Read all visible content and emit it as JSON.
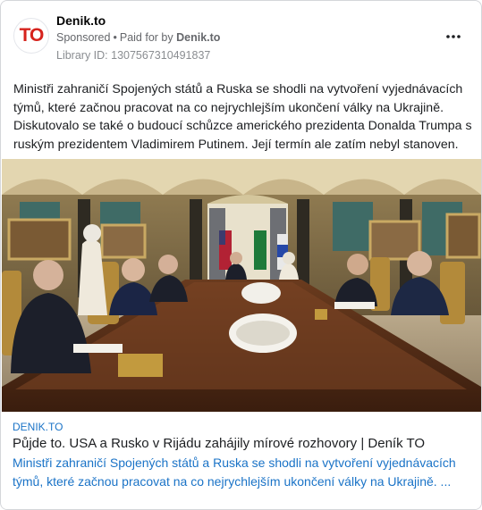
{
  "ad": {
    "page_name": "Denik.to",
    "avatar_text": "TO",
    "avatar_color": "#d6231d",
    "sponsored": "Sponsored",
    "paid_for_by": "Paid for by",
    "paid_for_by_name": "Denik.to",
    "library_id": "Library ID: 1307567310491837",
    "more_icon": "more-horizontal-icon",
    "body_text": "Ministři zahraničí Spojených států a Ruska se shodli na vytvoření vyjednávacích týmů, které začnou pracovat na co nejrychlejším ukončení války na Ukrajině. Diskutovalo se také o budoucí schůzce amerického prezidenta Donalda Trumpa s ruským prezidentem Vladimirem Putinem. Její termín ale zatím nebyl stanoven."
  },
  "link": {
    "domain": "DENIK.TO",
    "headline": "Půjde to. USA a Rusko v Rijádu zahájily mírové rozhovory | Deník TO",
    "description": "Ministři zahraničí Spojených států a Ruska se shodli na vytvoření vyjednávacích týmů, které začnou pracovat na co nejrychlejším ukončení války na Ukrajině. ...",
    "link_color": "#1a73c7"
  }
}
